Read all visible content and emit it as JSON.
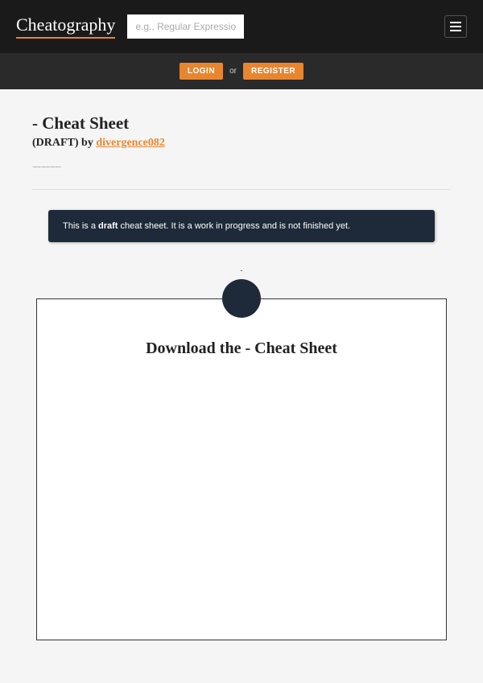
{
  "header": {
    "logo": "Cheatography",
    "search_placeholder": "e.g., Regular Expressions"
  },
  "auth": {
    "login_label": "LOGIN",
    "or_text": "or",
    "register_label": "REGISTER"
  },
  "page": {
    "title": "- Cheat Sheet",
    "draft_prefix": "(DRAFT) by ",
    "author": "divergence082",
    "dots": "............................."
  },
  "notice": {
    "prefix": "This is a ",
    "bold": "draft",
    "suffix": " cheat sheet. It is a work in progress and is not finished yet."
  },
  "mini": "-",
  "download": {
    "title": "Download the - Cheat Sheet"
  }
}
